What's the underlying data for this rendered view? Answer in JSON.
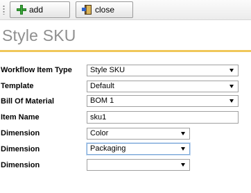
{
  "toolbar": {
    "add_label": "add",
    "close_label": "close"
  },
  "page": {
    "title": "Style SKU",
    "accent_color": "#f0c75a"
  },
  "form": {
    "workflow_item_type": {
      "label": "Workflow Item Type",
      "value": "Style SKU"
    },
    "template": {
      "label": "Template",
      "value": "Default"
    },
    "bill_of_material": {
      "label": "Bill Of Material",
      "value": "BOM 1"
    },
    "item_name": {
      "label": "Item Name",
      "value": "sku1"
    },
    "dimensions": [
      {
        "label": "Dimension",
        "value": "Color"
      },
      {
        "label": "Dimension",
        "value": "Packaging"
      },
      {
        "label": "Dimension",
        "value": ""
      }
    ]
  }
}
